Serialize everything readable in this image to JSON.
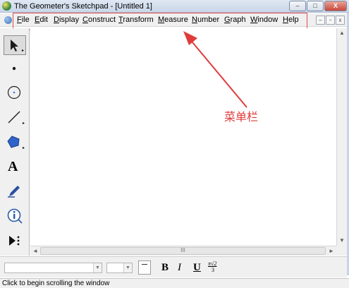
{
  "window": {
    "title": "The Geometer's Sketchpad - [Untitled 1]",
    "controls": {
      "minimize": "–",
      "maximize": "□",
      "close": "X"
    }
  },
  "menubar": {
    "items": [
      {
        "label": "File",
        "underline": "F",
        "rest": "ile"
      },
      {
        "label": "Edit",
        "underline": "E",
        "rest": "dit"
      },
      {
        "label": "Display",
        "underline": "D",
        "rest": "isplay"
      },
      {
        "label": "Construct",
        "underline": "C",
        "rest": "onstruct"
      },
      {
        "label": "Transform",
        "underline": "T",
        "rest": "ransform"
      },
      {
        "label": "Measure",
        "underline": "M",
        "rest": "easure"
      },
      {
        "label": "Number",
        "underline": "N",
        "rest": "umber"
      },
      {
        "label": "Graph",
        "underline": "G",
        "rest": "raph"
      },
      {
        "label": "Window",
        "underline": "W",
        "rest": "indow"
      },
      {
        "label": "Help",
        "underline": "H",
        "rest": "elp"
      }
    ],
    "mdi_controls": {
      "minimize": "–",
      "restore": "▫",
      "close": "x"
    }
  },
  "toolbox": {
    "tools": [
      {
        "name": "arrow-select-tool"
      },
      {
        "name": "point-tool"
      },
      {
        "name": "compass-tool"
      },
      {
        "name": "straightedge-tool"
      },
      {
        "name": "polygon-tool"
      },
      {
        "name": "text-tool",
        "glyph": "A"
      },
      {
        "name": "marker-tool"
      },
      {
        "name": "information-tool"
      },
      {
        "name": "custom-tool"
      }
    ]
  },
  "annotation": {
    "text": "菜单栏",
    "color": "#e03b3b"
  },
  "scrollbar": {
    "thumb_grip": "III"
  },
  "text_toolbar": {
    "bold": "B",
    "italic": "I",
    "underline": "U",
    "symbol_top": "π√2",
    "symbol_bottom": "3"
  },
  "status": {
    "text": "Click to begin scrolling the window"
  }
}
